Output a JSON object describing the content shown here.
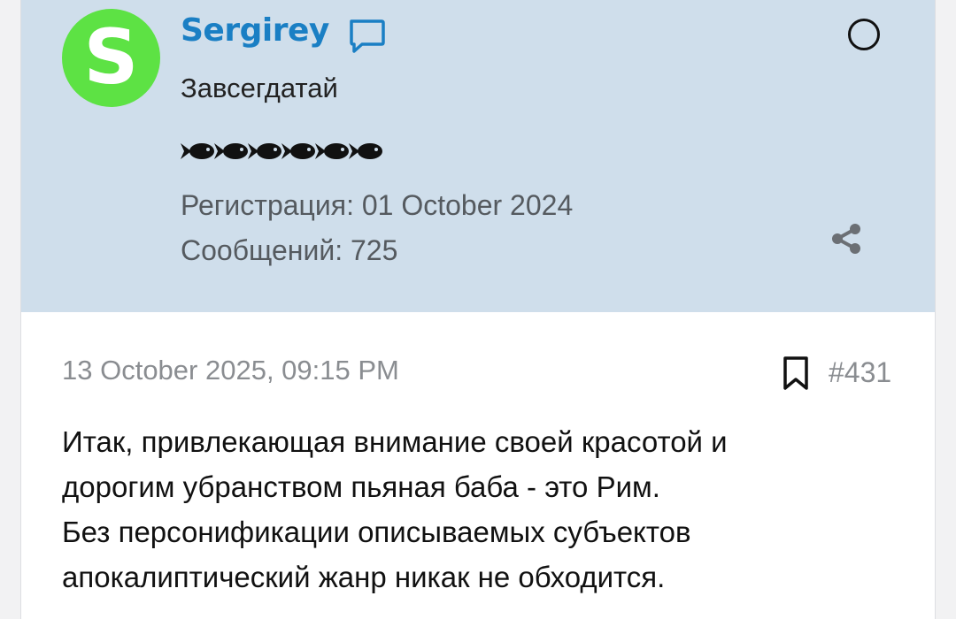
{
  "author": {
    "avatar_letter": "S",
    "avatar_color": "#5de244",
    "username": "Sergirey",
    "username_color": "#1a7fc4",
    "title": "Завсегдатай",
    "rank_icon": "fish-icon",
    "rank_count": 6,
    "registration": "Регистрация: 01 October 2024",
    "posts": "Сообщений: 725",
    "header_bg": "#cfdeeb"
  },
  "post": {
    "date": "13 October 2025, 09:15 PM",
    "number": "#431",
    "lines": [
      "Итак, привлекающая внимание своей красотой и",
      "дорогим убранством пьяная баба - это Рим.",
      "Без персонификации описываемых субъектов",
      "апокалиптический жанр никак не обходится."
    ]
  },
  "icons": {
    "chat": "chat-bubble-icon",
    "select": "select-circle-icon",
    "share": "share-icon",
    "bookmark": "bookmark-icon"
  }
}
